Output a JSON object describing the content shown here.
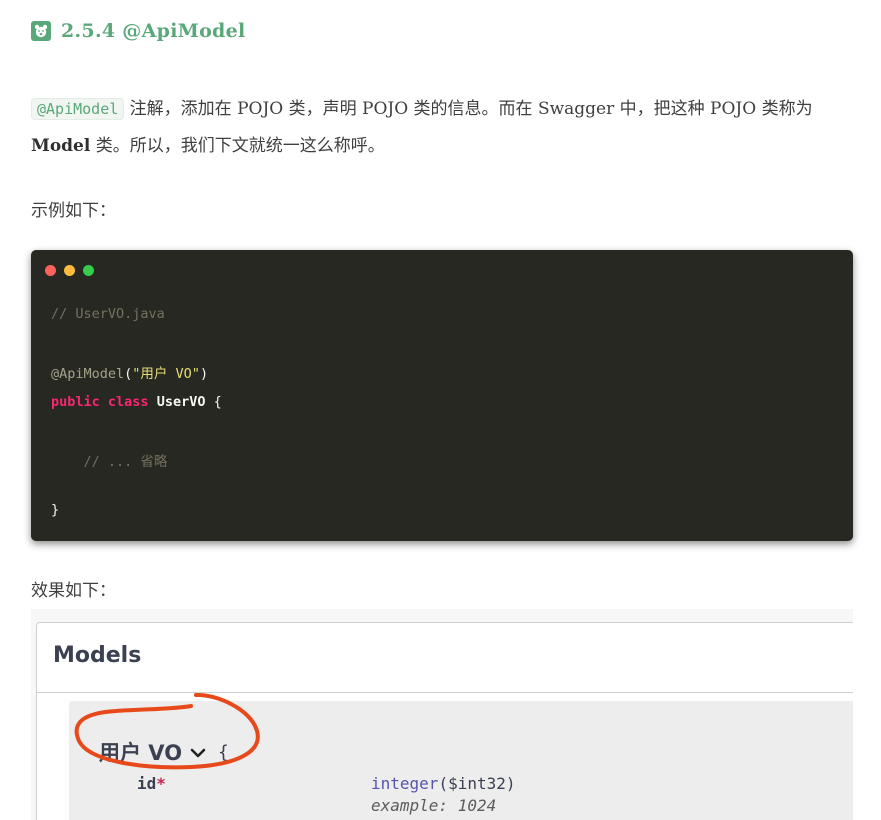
{
  "heading": {
    "icon": "bear-icon",
    "title": "2.5.4 @ApiModel"
  },
  "intro": {
    "code": "@ApiModel",
    "text1": " 注解，添加在 POJO 类，声明 POJO 类的信息。而在 Swagger 中，把这种 POJO 类称为 ",
    "bold": "Model",
    "text2": " 类。所以，我们下文就统一这么称呼。"
  },
  "example_label": "示例如下：",
  "code_block": {
    "dot_colors": [
      "#fc625d",
      "#fdbc40",
      "#35cd4b"
    ],
    "lines": {
      "comment": "// UserVO.java",
      "anno": "@ApiModel",
      "anno_open": "(",
      "anno_str": "\"用户 VO\"",
      "anno_close": ")",
      "kw1": "public",
      "kw2": "class",
      "cls": "UserVO",
      "open": " {",
      "body_comment": "    // ... 省略",
      "close": "}"
    }
  },
  "effect_label": "效果如下：",
  "swagger": {
    "models_title": "Models",
    "model_name": "用户 VO",
    "expand_icon": "chevron-down-icon",
    "brace": "{",
    "property": {
      "name": "id",
      "required_mark": "*",
      "type": "integer",
      "format": "($int32)",
      "example": "example: 1024"
    },
    "annotation_color": "#e8491b"
  }
}
